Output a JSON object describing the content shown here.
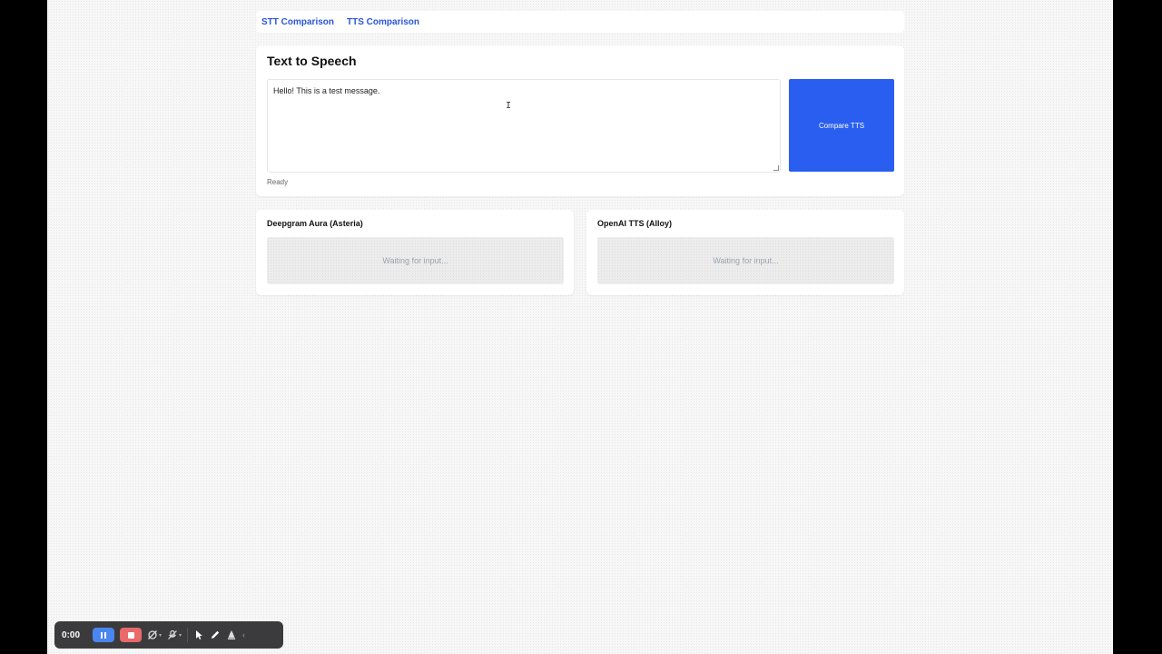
{
  "nav": {
    "links": [
      "STT Comparison",
      "TTS Comparison"
    ]
  },
  "main": {
    "title": "Text to Speech",
    "input_value": "Hello! This is a test message.",
    "button_label": "Compare TTS",
    "status": "Ready"
  },
  "results": [
    {
      "title": "Deepgram Aura (Asteria)",
      "placeholder": "Waiting for input..."
    },
    {
      "title": "OpenAI TTS (Alloy)",
      "placeholder": "Waiting for input..."
    }
  ],
  "recorder": {
    "time": "0:00",
    "icons": [
      "pause-icon",
      "stop-icon",
      "camera-off-icon",
      "mic-off-icon",
      "pointer-icon",
      "pen-icon",
      "eraser-icon",
      "chevron-left-icon"
    ]
  },
  "colors": {
    "accent": "#2a5ef0",
    "link": "#2a56d6",
    "pause": "#4a86f0",
    "stop": "#e86a6a"
  }
}
